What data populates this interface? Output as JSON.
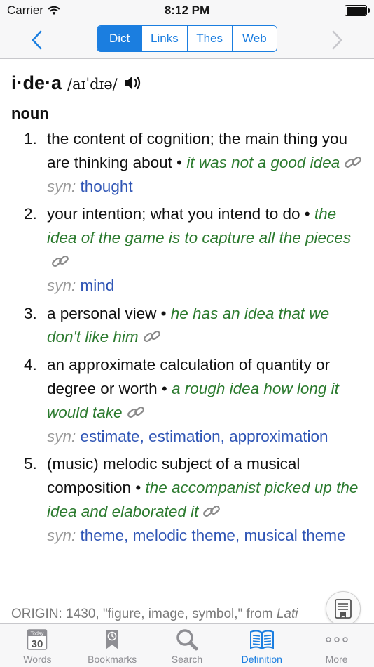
{
  "status": {
    "carrier": "Carrier",
    "time": "8:12 PM"
  },
  "nav": {
    "segments": [
      {
        "label": "Dict",
        "active": true
      },
      {
        "label": "Links",
        "active": false
      },
      {
        "label": "Thes",
        "active": false
      },
      {
        "label": "Web",
        "active": false
      }
    ]
  },
  "entry": {
    "headword": "i·de·a",
    "pronunciation": "/aɪˈdɪə/",
    "pos": "noun",
    "senses": [
      {
        "num": "1.",
        "definition": "the content of cognition; the main thing you are thinking about",
        "example": "it was not a good idea",
        "syn": [
          "thought"
        ]
      },
      {
        "num": "2.",
        "definition": "your intention; what you intend to do",
        "example": "the idea of the game is to capture all the pieces",
        "syn": [
          "mind"
        ]
      },
      {
        "num": "3.",
        "definition": "a personal view",
        "example": "he has an idea that we don't like him",
        "syn": []
      },
      {
        "num": "4.",
        "definition": "an approximate calculation of quantity or degree or worth",
        "example": "a rough idea how long it would take",
        "syn": [
          "estimate",
          "estimation",
          "approximation"
        ]
      },
      {
        "num": "5.",
        "definition": "(music) melodic subject of a musical composition",
        "example": "the accompanist picked up the idea and elaborated it",
        "syn": [
          "theme",
          "melodic theme",
          "musical theme"
        ]
      }
    ],
    "syn_label": "syn:",
    "origin_text": "ORIGIN: 1430, \"figure, image, symbol,\" from ",
    "origin_lang": "Lati"
  },
  "tabs": [
    {
      "label": "Words",
      "icon": "calendar-icon",
      "badge_top": "Today",
      "badge_num": "30",
      "active": false
    },
    {
      "label": "Bookmarks",
      "icon": "bookmark-clock-icon",
      "active": false
    },
    {
      "label": "Search",
      "icon": "search-icon",
      "active": false
    },
    {
      "label": "Definition",
      "icon": "book-icon",
      "active": true
    },
    {
      "label": "More",
      "icon": "more-icon",
      "active": false
    }
  ],
  "colors": {
    "accent": "#1b7ee0",
    "example": "#2b7a2e",
    "synonym": "#2f55b5",
    "syn_label": "#9a9a9a"
  }
}
